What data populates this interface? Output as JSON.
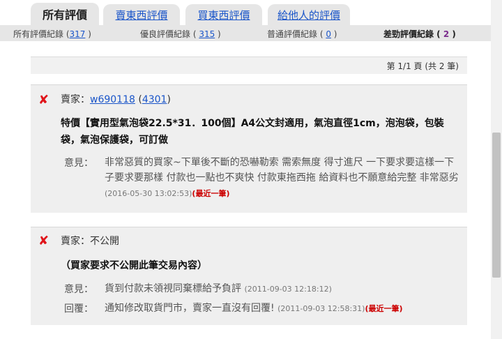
{
  "tabs": [
    {
      "label": "所有評價"
    },
    {
      "label": "賣東西評價"
    },
    {
      "label": "買東西評價"
    },
    {
      "label": "給他人的評價"
    }
  ],
  "stats": {
    "all": {
      "label": "所有評價紀錄 (",
      "count": "317",
      "close": " )"
    },
    "good": {
      "label": "優良評價紀錄 ( ",
      "count": "315",
      "close": " )"
    },
    "normal": {
      "label": "普通評價紀錄 ( ",
      "count": "0",
      "close": " )"
    },
    "bad": {
      "label": "差勁評價紀錄 ( ",
      "count": "2",
      "close": " )"
    }
  },
  "pager": {
    "text": "第 1/1 頁 (共 2 筆)"
  },
  "reviews": [
    {
      "role": "賣家：",
      "user": "w690118",
      "score": "4301",
      "product": "特價【實用型氣泡袋22.5*31．100個】A4公文封適用，氣泡直徑1cm，泡泡袋，包裝袋，氣泡保護袋，可訂做",
      "comment_label": "意見：",
      "comment": "非常惡質的買家~下單後不斷的恐嚇勒索 需索無度 得寸進尺 一下要求要這樣一下子要求要那樣 付款也一點也不爽快 付款東拖西拖 給資料也不願意給完整 非常惡劣 ",
      "timestamp": "(2016-05-30 13:02:53)",
      "latest": "(最近一筆)"
    },
    {
      "role": "賣家：不公開",
      "product": "（買家要求不公開此筆交易內容）",
      "comment_label": "意見：",
      "comment": "貨到付款未領視同棄標給予負評 ",
      "timestamp": "(2011-09-03 12:18:12)",
      "reply_label": "回覆：",
      "reply": "通知修改取貨門市，賣家一直沒有回覆! ",
      "reply_timestamp": "(2011-09-03 12:58:31)",
      "latest": "(最近一筆)"
    }
  ]
}
